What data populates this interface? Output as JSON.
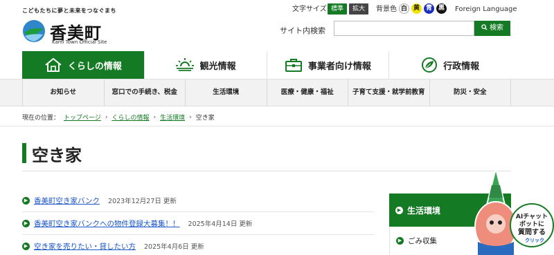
{
  "header": {
    "tagline": "こどもたちに夢と未来をつなぐまち",
    "logo_name": "香美町",
    "logo_en": "Kami Town Official Site",
    "font_size_label": "文字サイズ",
    "font_standard": "標準",
    "font_large": "拡大",
    "bg_color_label": "背景色",
    "bg_white": "白",
    "bg_yellow": "黄",
    "bg_blue": "青",
    "bg_black": "黒",
    "foreign_language": "Foreign Language",
    "search_label": "サイト内検索",
    "search_placeholder": "",
    "search_button": "検索"
  },
  "main_nav": [
    {
      "label": "くらしの情報",
      "icon": "house-icon",
      "active": true
    },
    {
      "label": "観光情報",
      "icon": "sunrise-icon",
      "active": false
    },
    {
      "label": "事業者向け情報",
      "icon": "briefcase-icon",
      "active": false
    },
    {
      "label": "行政情報",
      "icon": "leaf-globe-icon",
      "active": false
    }
  ],
  "sub_nav": [
    "お知らせ",
    "窓口での手続き、税金",
    "生活環境",
    "医療・健康・福祉",
    "子育て支援・就学前教育",
    "防災・安全"
  ],
  "breadcrumb": {
    "prefix": "現在の位置：",
    "items": [
      "トップページ",
      "くらしの情報",
      "生活環境"
    ],
    "current": "空き家"
  },
  "page_title": "空き家",
  "articles": [
    {
      "title": "香美町空き家バンク",
      "date": "2023年12月27日 更新"
    },
    {
      "title": "香美町空き家バンクへの物件登録大募集！！",
      "date": "2025年4月14日 更新"
    },
    {
      "title": "空き家を売りたい・貸したい方",
      "date": "2025年4月6日 更新"
    }
  ],
  "sidebar": {
    "heading": "生活環境",
    "items": [
      "ごみ収集"
    ]
  },
  "chatbot": {
    "line1": "AIチャット",
    "line2": "ボットに",
    "line3": "質問する",
    "line4": "クリック"
  },
  "colors": {
    "accent": "#147a24",
    "link": "#1a56c8"
  }
}
